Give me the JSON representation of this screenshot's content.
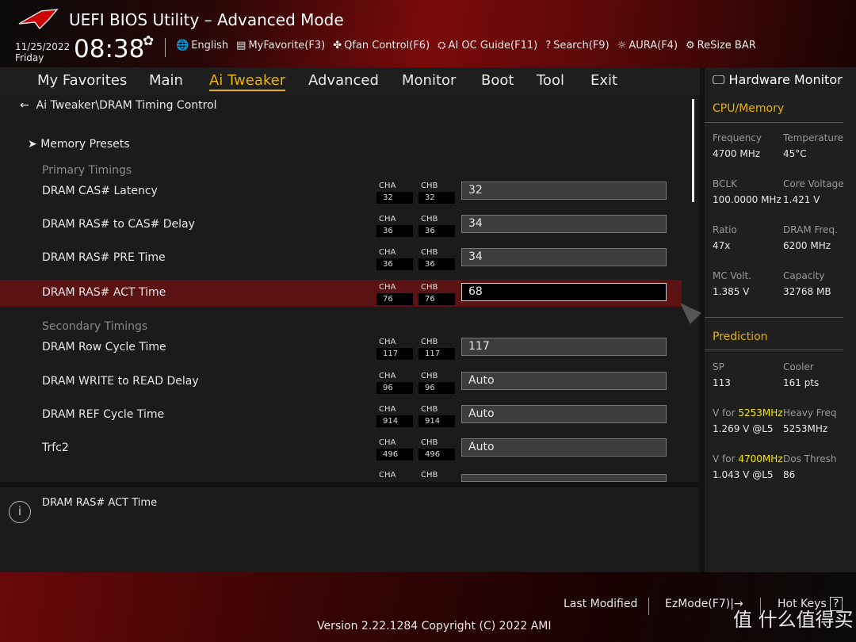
{
  "header": {
    "title": "UEFI BIOS Utility – Advanced Mode",
    "date": "11/25/2022",
    "day": "Friday",
    "time": "08:38",
    "tools": [
      {
        "icon": "globe-icon",
        "label": "English"
      },
      {
        "icon": "favorite-icon",
        "label": "MyFavorite(F3)"
      },
      {
        "icon": "fan-icon",
        "label": "Qfan Control(F6)"
      },
      {
        "icon": "ai-oc-icon",
        "label": "AI OC Guide(F11)"
      },
      {
        "icon": "search-icon",
        "label": "Search(F9)"
      },
      {
        "icon": "aura-icon",
        "label": "AURA(F4)"
      },
      {
        "icon": "resize-bar-icon",
        "label": "ReSize BAR"
      }
    ]
  },
  "nav": {
    "tabs": [
      "My Favorites",
      "Main",
      "Ai Tweaker",
      "Advanced",
      "Monitor",
      "Boot",
      "Tool",
      "Exit"
    ],
    "active": "Ai Tweaker"
  },
  "main": {
    "breadcrumb": "Ai Tweaker\\DRAM Timing Control",
    "memory_presets": "Memory Presets",
    "primary": "Primary Timings",
    "secondary": "Secondary Timings",
    "cha": "CHA",
    "chb": "CHB",
    "rows": [
      {
        "label": "DRAM CAS# Latency",
        "cha": "32",
        "chb": "32",
        "value": "32"
      },
      {
        "label": "DRAM RAS# to CAS# Delay",
        "cha": "36",
        "chb": "36",
        "value": "34"
      },
      {
        "label": "DRAM RAS# PRE Time",
        "cha": "36",
        "chb": "36",
        "value": "34"
      },
      {
        "label": "DRAM RAS# ACT Time",
        "cha": "76",
        "chb": "76",
        "value": "68"
      },
      {
        "label": "DRAM Row Cycle Time",
        "cha": "117",
        "chb": "117",
        "value": "117"
      },
      {
        "label": "DRAM WRITE to READ Delay",
        "cha": "96",
        "chb": "96",
        "value": "Auto"
      },
      {
        "label": "DRAM REF Cycle Time",
        "cha": "914",
        "chb": "914",
        "value": "Auto"
      },
      {
        "label": "Trfc2",
        "cha": "496",
        "chb": "496",
        "value": "Auto"
      }
    ]
  },
  "help": {
    "text": "DRAM RAS# ACT Time"
  },
  "monitor": {
    "title": "Hardware Monitor",
    "cpu_mem": "CPU/Memory",
    "items": [
      [
        "Frequency",
        "4700 MHz"
      ],
      [
        "Temperature",
        "45°C"
      ],
      [
        "BCLK",
        "100.0000 MHz"
      ],
      [
        "Core Voltage",
        "1.421 V"
      ],
      [
        "Ratio",
        "47x"
      ],
      [
        "DRAM Freq.",
        "6200 MHz"
      ],
      [
        "MC Volt.",
        "1.385 V"
      ],
      [
        "Capacity",
        "32768 MB"
      ]
    ],
    "prediction": "Prediction",
    "pred": {
      "sp_k": "SP",
      "sp_v": "113",
      "cooler_k": "Cooler",
      "cooler_v": "161 pts",
      "v1_prefix": "V for ",
      "v1_freq": "5253MHz",
      "v1_v": "1.269 V @L5",
      "hf_k": "Heavy Freq",
      "hf_v": "5253MHz",
      "v2_prefix": "V for ",
      "v2_freq": "4700MHz",
      "v2_v": "1.043 V @L5",
      "dt_k": "Dos Thresh",
      "dt_v": "86"
    }
  },
  "footer": {
    "last_modified": "Last Modified",
    "ezmode": "EzMode(F7)|→",
    "hotkeys": "Hot Keys",
    "version": "Version 2.22.1284 Copyright (C) 2022 AMI",
    "watermark": "值 什么值得买"
  },
  "colors": {
    "accent": "#e8b200",
    "highlight": "#5a1212",
    "yellow": "#f2e600"
  }
}
